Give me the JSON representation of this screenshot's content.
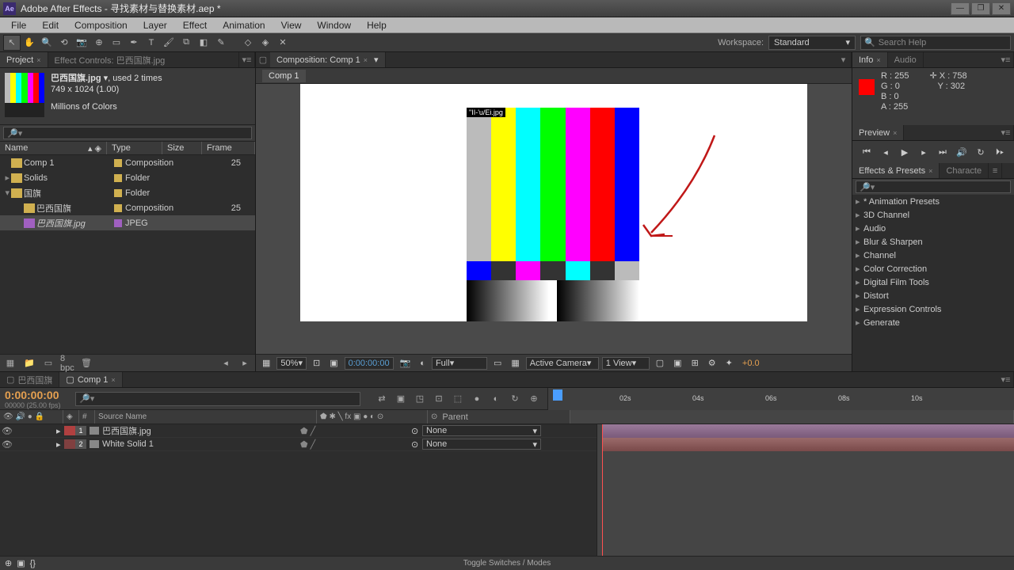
{
  "title": "Adobe After Effects - 寻找素材与替换素材.aep *",
  "menu": [
    "File",
    "Edit",
    "Composition",
    "Layer",
    "Effect",
    "Animation",
    "View",
    "Window",
    "Help"
  ],
  "workspace_label": "Workspace:",
  "workspace_value": "Standard",
  "search_help_ph": "Search Help",
  "project_tab": "Project",
  "effect_ctrl_tab": "Effect Controls: 巴西国旗.jpg",
  "asset": {
    "name": "巴西国旗.jpg",
    "used": ", used 2 times",
    "dims": "749 x 1024 (1.00)",
    "colors": "Millions of Colors"
  },
  "proj_cols": {
    "name": "Name",
    "type": "Type",
    "size": "Size",
    "frame": "Frame"
  },
  "proj_items": [
    {
      "indent": 0,
      "arrow": "",
      "icon": "comp",
      "name": "Comp 1",
      "type": "Composition",
      "frame": "25",
      "swatch": "#d0b050"
    },
    {
      "indent": 0,
      "arrow": "▸",
      "icon": "folder",
      "name": "Solids",
      "type": "Folder",
      "frame": "",
      "swatch": "#d0b050"
    },
    {
      "indent": 0,
      "arrow": "▾",
      "icon": "folder",
      "name": "国旗",
      "type": "Folder",
      "frame": "",
      "swatch": "#d0b050"
    },
    {
      "indent": 1,
      "arrow": "",
      "icon": "comp",
      "name": "巴西国旗",
      "type": "Composition",
      "frame": "25",
      "swatch": "#d0b050"
    },
    {
      "indent": 1,
      "arrow": "",
      "icon": "jpeg",
      "name": "巴西国旗.jpg",
      "type": "JPEG",
      "frame": "",
      "swatch": "#a060c0",
      "sel": true,
      "italic": true
    }
  ],
  "bpc": "8 bpc",
  "comp_panel": "Composition: Comp 1",
  "bread": "Comp 1",
  "tc_label": "\"II-'u/Ei.jpg",
  "viewer": {
    "zoom": "50%",
    "tc": "0:00:00:00",
    "res": "Full",
    "cam": "Active Camera",
    "view": "1 View",
    "exp": "+0.0"
  },
  "info": {
    "tab": "Info",
    "audio": "Audio",
    "r": "R : 255",
    "g": "G : 0",
    "b": "B : 0",
    "a": "A : 255",
    "x": "X : 758",
    "y": "Y : 302"
  },
  "preview_tab": "Preview",
  "ep_tab": "Effects & Presets",
  "char_tab": "Characte",
  "ep_items": [
    "* Animation Presets",
    "3D Channel",
    "Audio",
    "Blur & Sharpen",
    "Channel",
    "Color Correction",
    "Digital Film Tools",
    "Distort",
    "Expression Controls",
    "Generate"
  ],
  "tl": {
    "tab1": "巴西国旗",
    "tab2": "Comp 1",
    "tc": "0:00:00:00",
    "fps": "00000 (25.00 fps)",
    "col_num": "#",
    "col_src": "Source Name",
    "col_parent": "Parent",
    "layers": [
      {
        "num": "1",
        "name": "巴西国旗.jpg",
        "parent": "None",
        "color": "#b04040"
      },
      {
        "num": "2",
        "name": "White Solid 1",
        "parent": "None",
        "color": "#804040"
      }
    ],
    "ticks": [
      "02s",
      "04s",
      "06s",
      "08s",
      "10s"
    ],
    "toggle": "Toggle Switches / Modes"
  }
}
